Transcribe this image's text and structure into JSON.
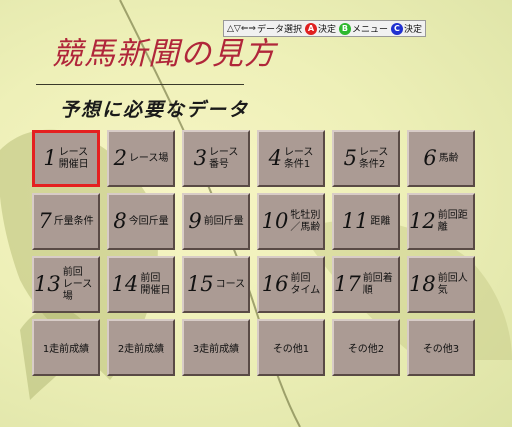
{
  "title": "競馬新聞の見方",
  "subtitle": "予想に必要なデータ",
  "controls": [
    {
      "icon": "dpad-arrows-icon",
      "symbol": "△▽⇐⇒",
      "label": "データ選択",
      "color": ""
    },
    {
      "icon": "a-button-icon",
      "symbol": "A",
      "label": "決定",
      "color": "#e02020"
    },
    {
      "icon": "b-button-icon",
      "symbol": "B",
      "label": "メニュー",
      "color": "#2eb82e"
    },
    {
      "icon": "c-button-icon",
      "symbol": "C",
      "label": "決定",
      "color": "#2030d0"
    }
  ],
  "colors": {
    "cell_face": "#ab9b94",
    "selection_border": "#e42020",
    "title_text": "#b0263a"
  },
  "grid": [
    {
      "num": "1",
      "label": "レース\n開催日",
      "selected": true
    },
    {
      "num": "2",
      "label": "レース場",
      "selected": false
    },
    {
      "num": "3",
      "label": "レース\n番号",
      "selected": false
    },
    {
      "num": "4",
      "label": "レース\n条件1",
      "selected": false
    },
    {
      "num": "5",
      "label": "レース\n条件2",
      "selected": false
    },
    {
      "num": "6",
      "label": "馬齢",
      "selected": false
    },
    {
      "num": "7",
      "label": "斤量条件",
      "selected": false
    },
    {
      "num": "8",
      "label": "今回斤量",
      "selected": false
    },
    {
      "num": "9",
      "label": "前回斤量",
      "selected": false
    },
    {
      "num": "10",
      "label": "牝牡別\n／馬齢",
      "selected": false
    },
    {
      "num": "11",
      "label": "距離",
      "selected": false
    },
    {
      "num": "12",
      "label": "前回距離",
      "selected": false
    },
    {
      "num": "13",
      "label": "前回\nレース場",
      "selected": false
    },
    {
      "num": "14",
      "label": "前回\n開催日",
      "selected": false
    },
    {
      "num": "15",
      "label": "コース",
      "selected": false
    },
    {
      "num": "16",
      "label": "前回\nタイム",
      "selected": false
    },
    {
      "num": "17",
      "label": "前回着順",
      "selected": false
    },
    {
      "num": "18",
      "label": "前回人気",
      "selected": false
    },
    {
      "num": "",
      "label": "1走前成績",
      "selected": false
    },
    {
      "num": "",
      "label": "2走前成績",
      "selected": false
    },
    {
      "num": "",
      "label": "3走前成績",
      "selected": false
    },
    {
      "num": "",
      "label": "その他1",
      "selected": false
    },
    {
      "num": "",
      "label": "その他2",
      "selected": false
    },
    {
      "num": "",
      "label": "その他3",
      "selected": false
    }
  ]
}
